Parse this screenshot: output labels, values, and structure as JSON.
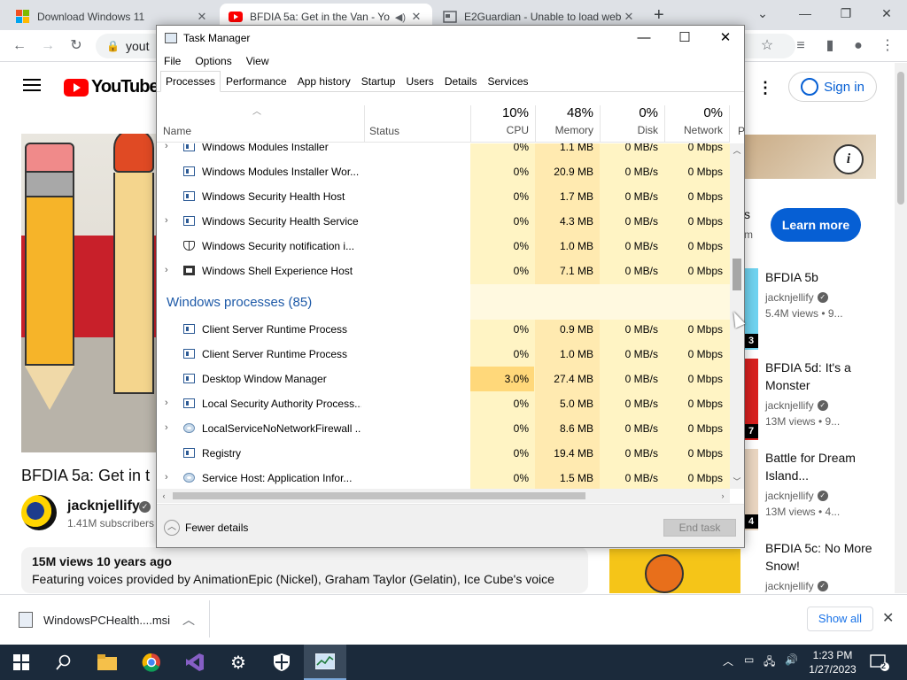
{
  "browser": {
    "tabs": [
      {
        "title": "Download Windows 11",
        "icon": "windows-logo-icon"
      },
      {
        "title": "BFDIA 5a: Get in the Van - Yo",
        "icon": "youtube-icon",
        "audio": true
      },
      {
        "title": "E2Guardian - Unable to load web",
        "icon": "page-icon"
      }
    ],
    "new_tab": "+",
    "url": "yout"
  },
  "youtube": {
    "logo_text": "YouTube",
    "sign_in": "Sign in",
    "video_title": "BFDIA 5a: Get in t",
    "channel_name": "jacknjellify",
    "subscribers": "1.41M subscribers",
    "description_meta": "15M views  10 years ago",
    "description_text": "Featuring voices provided by AnimationEpic (Nickel), Graham Taylor (Gelatin), Ice Cube's voice",
    "ad_fragment": "s",
    "ad_fragment2": "m",
    "learn_more": "Learn more",
    "info": "i",
    "recommendations": [
      {
        "title": "BFDIA 5b",
        "channel": "jacknjellify",
        "views": "5.4M views  • 9...",
        "time": "3"
      },
      {
        "title": "BFDIA 5d: It's a Monster",
        "channel": "jacknjellify",
        "views": "13M views  • 9...",
        "time": "7"
      },
      {
        "title": "Battle for Dream Island...",
        "channel": "jacknjellify",
        "views": "13M views  • 4...",
        "time": "4"
      },
      {
        "title": "BFDIA 5c: No More Snow!",
        "channel": "jacknjellify",
        "views": "",
        "time": ""
      }
    ]
  },
  "task_manager": {
    "title": "Task Manager",
    "menu": [
      "File",
      "Options",
      "View"
    ],
    "tabs": [
      "Processes",
      "Performance",
      "App history",
      "Startup",
      "Users",
      "Details",
      "Services"
    ],
    "columns": {
      "name": "Name",
      "status": "Status",
      "cpu": {
        "pct": "10%",
        "label": "CPU"
      },
      "memory": {
        "pct": "48%",
        "label": "Memory"
      },
      "disk": {
        "pct": "0%",
        "label": "Disk"
      },
      "network": {
        "pct": "0%",
        "label": "Network"
      },
      "power": "P"
    },
    "rows_apps": [
      {
        "name": "Windows Modules Installer",
        "cpu": "0%",
        "mem": "1.1 MB",
        "disk": "0 MB/s",
        "net": "0 Mbps",
        "icon": "app",
        "expand": true
      },
      {
        "name": "Windows Modules Installer Wor...",
        "cpu": "0%",
        "mem": "20.9 MB",
        "disk": "0 MB/s",
        "net": "0 Mbps",
        "icon": "app",
        "expand": false
      },
      {
        "name": "Windows Security Health Host",
        "cpu": "0%",
        "mem": "1.7 MB",
        "disk": "0 MB/s",
        "net": "0 Mbps",
        "icon": "app",
        "expand": false
      },
      {
        "name": "Windows Security Health Service",
        "cpu": "0%",
        "mem": "4.3 MB",
        "disk": "0 MB/s",
        "net": "0 Mbps",
        "icon": "app",
        "expand": true
      },
      {
        "name": "Windows Security notification i...",
        "cpu": "0%",
        "mem": "1.0 MB",
        "disk": "0 MB/s",
        "net": "0 Mbps",
        "icon": "shield",
        "expand": false
      },
      {
        "name": "Windows Shell Experience Host",
        "cpu": "0%",
        "mem": "7.1 MB",
        "disk": "0 MB/s",
        "net": "0 Mbps",
        "icon": "shell",
        "expand": true
      }
    ],
    "group_windows": "Windows processes (85)",
    "rows_windows": [
      {
        "name": "Client Server Runtime Process",
        "cpu": "0%",
        "mem": "0.9 MB",
        "disk": "0 MB/s",
        "net": "0 Mbps",
        "icon": "app",
        "expand": false
      },
      {
        "name": "Client Server Runtime Process",
        "cpu": "0%",
        "mem": "1.0 MB",
        "disk": "0 MB/s",
        "net": "0 Mbps",
        "icon": "app",
        "expand": false
      },
      {
        "name": "Desktop Window Manager",
        "cpu": "3.0%",
        "mem": "27.4 MB",
        "disk": "0 MB/s",
        "net": "0 Mbps",
        "icon": "app",
        "expand": false
      },
      {
        "name": "Local Security Authority Process...",
        "cpu": "0%",
        "mem": "5.0 MB",
        "disk": "0 MB/s",
        "net": "0 Mbps",
        "icon": "app",
        "expand": true
      },
      {
        "name": "LocalServiceNoNetworkFirewall ...",
        "cpu": "0%",
        "mem": "8.6 MB",
        "disk": "0 MB/s",
        "net": "0 Mbps",
        "icon": "gear",
        "expand": true
      },
      {
        "name": "Registry",
        "cpu": "0%",
        "mem": "19.4 MB",
        "disk": "0 MB/s",
        "net": "0 Mbps",
        "icon": "app",
        "expand": false
      },
      {
        "name": "Service Host: Application Infor...",
        "cpu": "0%",
        "mem": "1.5 MB",
        "disk": "0 MB/s",
        "net": "0 Mbps",
        "icon": "gear",
        "expand": true
      }
    ],
    "fewer_details": "Fewer details",
    "end_task": "End task"
  },
  "download": {
    "file": "WindowsPCHealth....msi",
    "show_all": "Show all"
  },
  "taskbar": {
    "time": "1:23 PM",
    "date": "1/27/2023",
    "notification_count": "2"
  },
  "colors": {
    "heat_light": "#fff4c4",
    "heat_mid": "#ffeab0",
    "accent": "#065fd4",
    "group": "#1e5aa8"
  }
}
